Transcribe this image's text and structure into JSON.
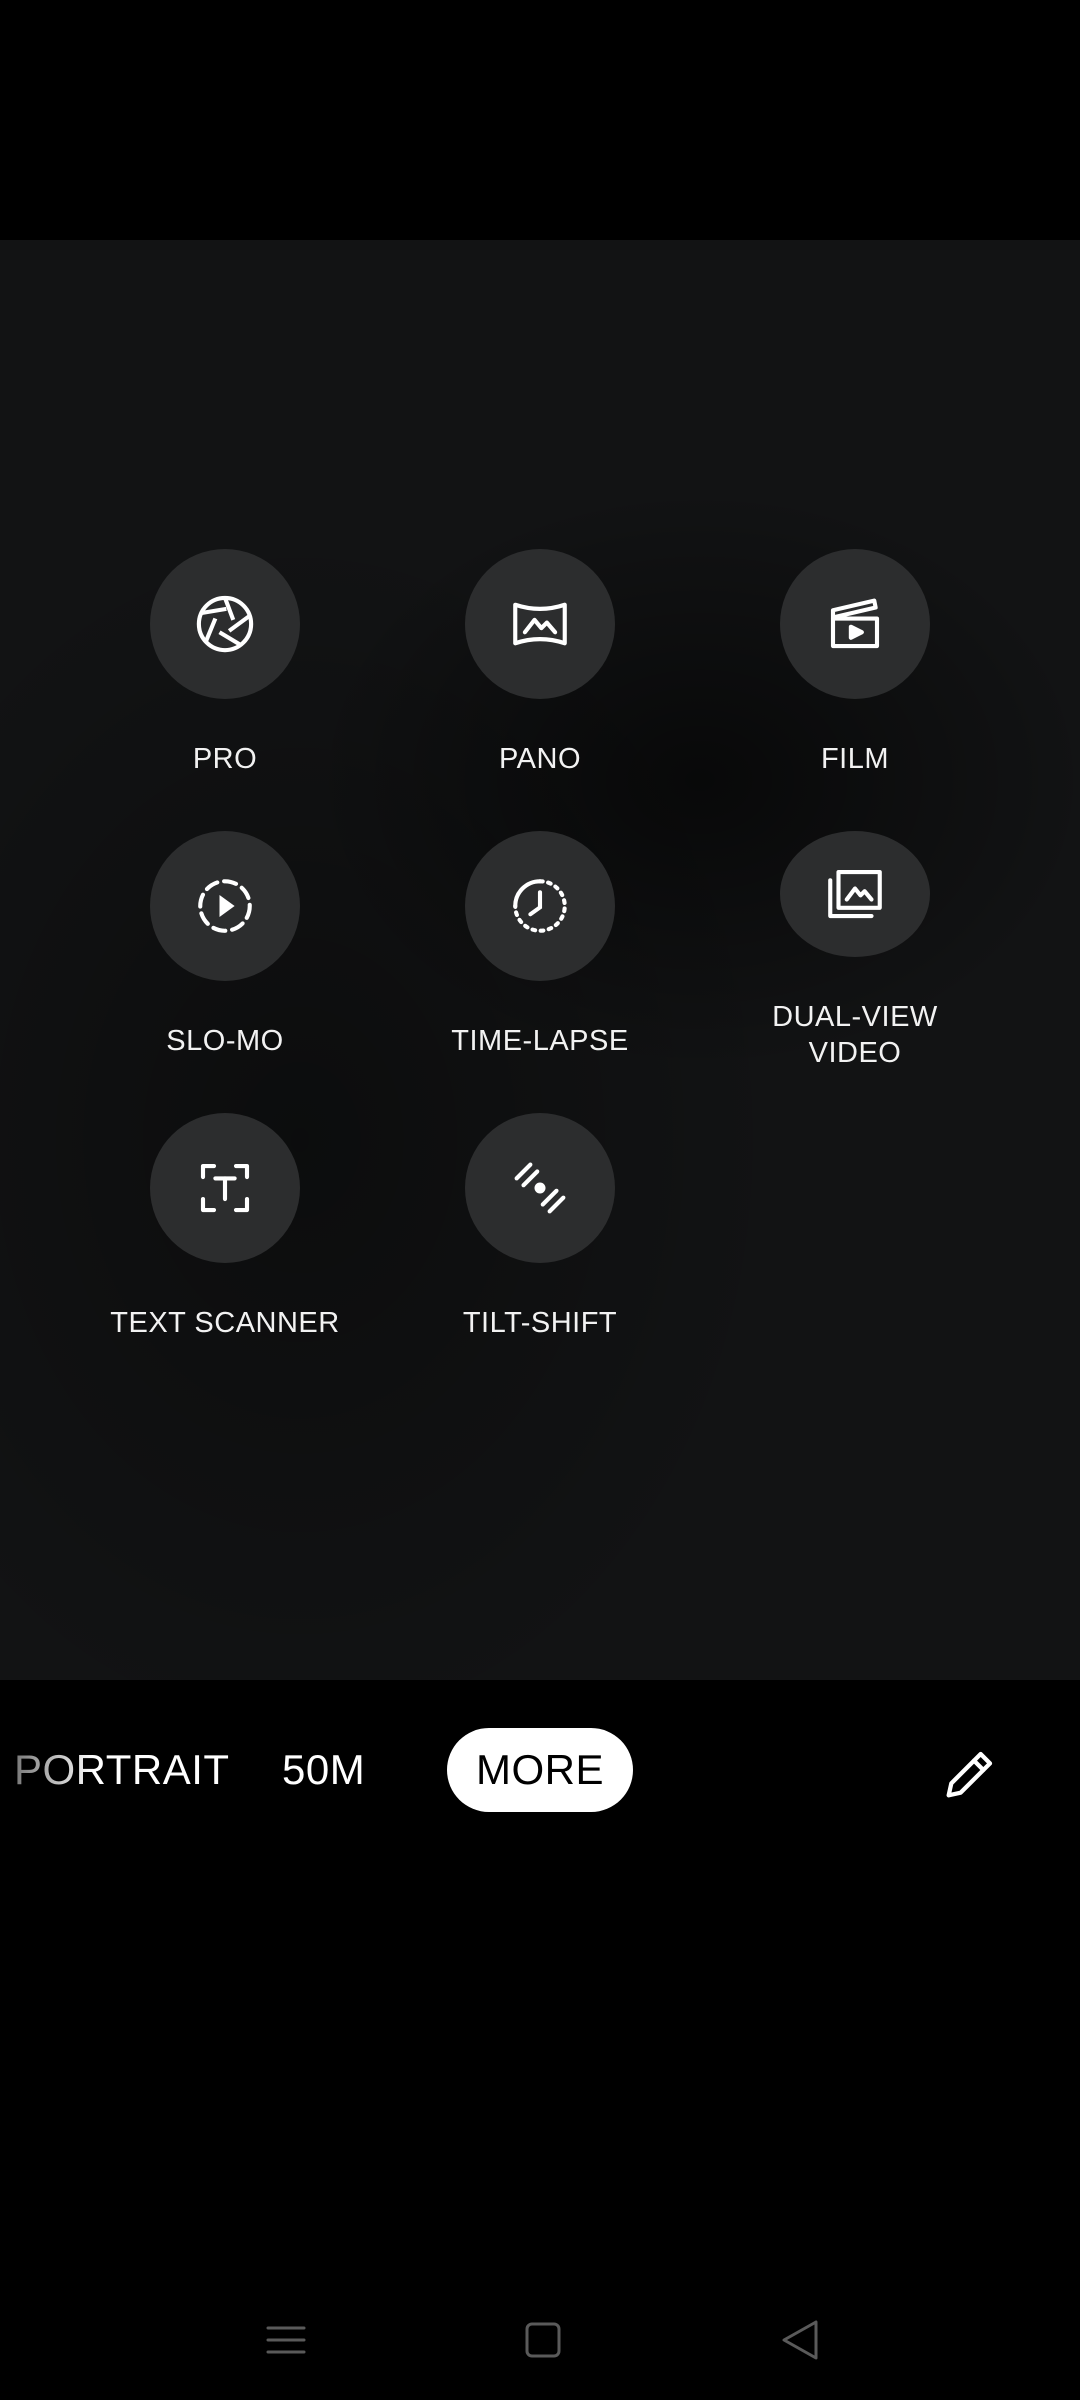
{
  "modes": [
    {
      "id": "pro",
      "label": "PRO",
      "icon": "aperture-icon"
    },
    {
      "id": "pano",
      "label": "PANO",
      "icon": "panorama-icon"
    },
    {
      "id": "film",
      "label": "FILM",
      "icon": "clapperboard-icon"
    },
    {
      "id": "slo-mo",
      "label": "SLO-MO",
      "icon": "slow-motion-icon"
    },
    {
      "id": "time-lapse",
      "label": "TIME-LAPSE",
      "icon": "time-lapse-icon"
    },
    {
      "id": "dual-view",
      "label": "DUAL-VIEW\nVIDEO",
      "icon": "dual-view-icon"
    },
    {
      "id": "text-scanner",
      "label": "TEXT SCANNER",
      "icon": "text-scan-icon"
    },
    {
      "id": "tilt-shift",
      "label": "TILT-SHIFT",
      "icon": "tilt-shift-icon"
    }
  ],
  "mode_strip": {
    "portrait": "PORTRAIT",
    "fifty_m": "50M",
    "more": "MORE",
    "edit_icon": "pencil-icon"
  },
  "nav": {
    "menu_icon": "menu-lines-icon",
    "home_icon": "square-home-icon",
    "back_icon": "triangle-back-icon"
  },
  "colors": {
    "background": "#000000",
    "viewfinder": "#121314",
    "mode_circle": "#2c2d2e",
    "active_pill": "#ffffff"
  }
}
